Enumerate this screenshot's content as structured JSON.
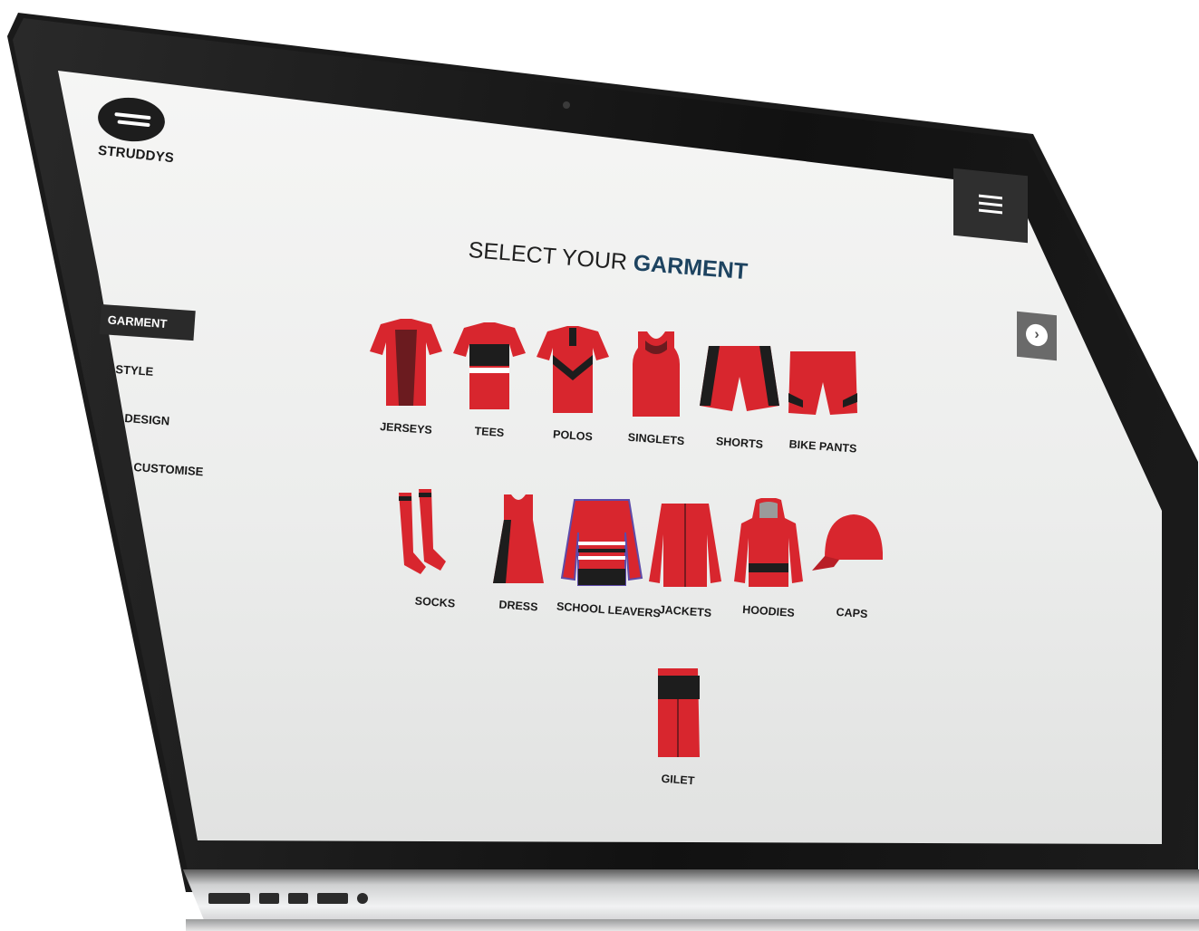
{
  "brand": {
    "name": "STRUDDYS"
  },
  "heading": {
    "prefix": "SELECT YOUR",
    "highlight": "GARMENT"
  },
  "steps": [
    {
      "label": "GARMENT",
      "active": true
    },
    {
      "label": "STYLE",
      "active": false
    },
    {
      "label": "DESIGN",
      "active": false
    },
    {
      "label": "CUSTOMISE",
      "active": false
    }
  ],
  "garments": [
    {
      "label": "JERSEYS",
      "icon": "jersey-icon"
    },
    {
      "label": "TEES",
      "icon": "tee-icon"
    },
    {
      "label": "POLOS",
      "icon": "polo-icon"
    },
    {
      "label": "SINGLETS",
      "icon": "singlet-icon"
    },
    {
      "label": "SHORTS",
      "icon": "shorts-icon"
    },
    {
      "label": "BIKE PANTS",
      "icon": "bike-pants-icon"
    },
    {
      "label": "SOCKS",
      "icon": "socks-icon"
    },
    {
      "label": "DRESS",
      "icon": "dress-icon"
    },
    {
      "label": "SCHOOL LEAVERS",
      "icon": "school-leavers-icon"
    },
    {
      "label": "JACKETS",
      "icon": "jacket-icon"
    },
    {
      "label": "HOODIES",
      "icon": "hoodie-icon"
    },
    {
      "label": "CAPS",
      "icon": "cap-icon"
    },
    {
      "label": "GILET",
      "icon": "gilet-icon"
    }
  ],
  "colors": {
    "accent": "#d8262e",
    "dark": "#1d1d1d",
    "heading_highlight": "#1d4360"
  }
}
